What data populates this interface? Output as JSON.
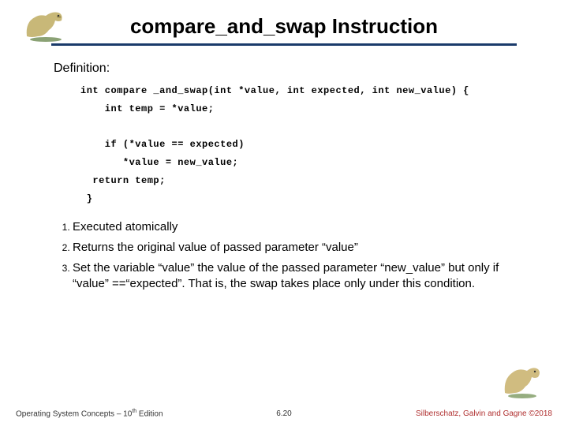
{
  "title": "compare_and_swap Instruction",
  "definition_label": "Definition:",
  "code": {
    "l1": "int compare _and_swap(int *value, int expected, int new_value) {",
    "l2": "    int temp = *value;",
    "l3": "",
    "l4": "    if (*value == expected)",
    "l5": "       *value = new_value;",
    "l6": "  return temp;",
    "l7": " }"
  },
  "points": [
    "Executed atomically",
    "Returns the original value of passed parameter “value”",
    "Set  the variable “value”  the value of the passed parameter “new_value” but only if “value” ==“expected”. That is, the swap takes place only under this condition."
  ],
  "footer": {
    "left_prefix": "Operating System Concepts – 10",
    "left_sup": "th",
    "left_suffix": " Edition",
    "center": "6.20",
    "right": "Silberschatz, Galvin and Gagne ©2018"
  },
  "icons": {
    "dino_left": "dinosaur-icon",
    "dino_right": "dinosaur-icon"
  },
  "colors": {
    "underline": "#1a3a6a",
    "credit": "#b03030"
  }
}
